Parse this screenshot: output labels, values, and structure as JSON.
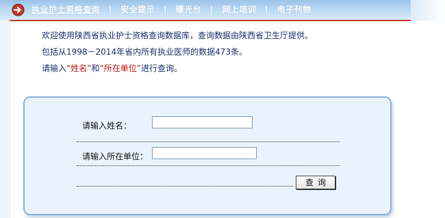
{
  "nav": {
    "items": [
      "执业护士资格查询",
      "安全提示",
      "曝光台",
      "网上培训",
      "电子刊物"
    ],
    "separator": "|",
    "colors": {
      "bar": "#9ac3ea",
      "underline": "#c0392b",
      "text": "#ffffff"
    }
  },
  "intro": {
    "line1": "欢迎使用陕西省执业护士资格查询数据库，查询数据由陕西省卫生厅提供。",
    "line2": "包括从1998－2014年省内所有执业医师的数据473条。",
    "line3_prefix": "请输入",
    "line3_open_quote1": "“",
    "line3_field1": "姓名",
    "line3_close_quote1": "”",
    "line3_and": "和",
    "line3_open_quote2": "“",
    "line3_field2": "所在单位",
    "line3_close_quote2": "”",
    "line3_suffix": "进行查询。",
    "colors": {
      "text": "#1a2f6b",
      "highlight": "#c0150c"
    }
  },
  "form": {
    "name_label": "请输入姓名：",
    "name_value": "",
    "unit_label": "请输入所在单位：",
    "unit_value": "",
    "submit_label": "查询",
    "colors": {
      "panel": "#eaf3fb",
      "border": "#86b2dd"
    }
  }
}
